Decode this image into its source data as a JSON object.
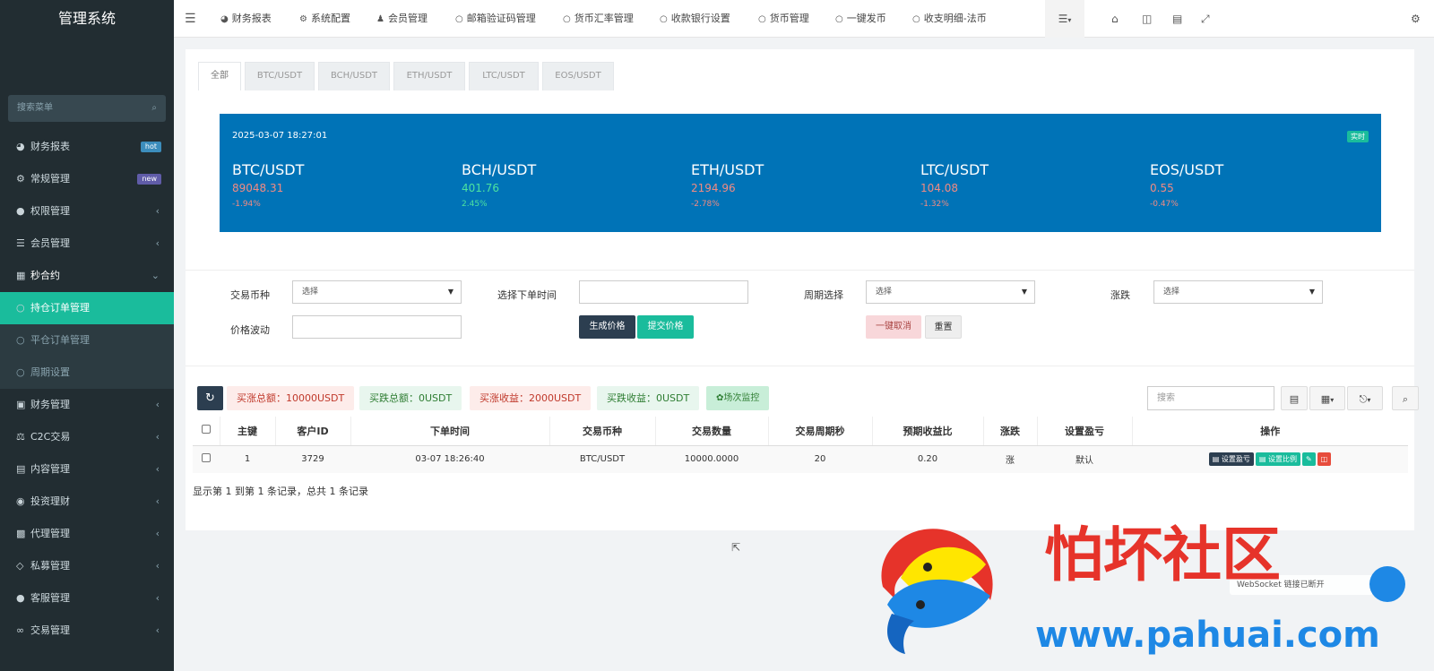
{
  "sidebar": {
    "brand": "管理系统",
    "search_placeholder": "搜索菜单",
    "items": [
      {
        "label": "财务报表",
        "icon": "dashboard-icon",
        "badge": "hot",
        "badge_color": "#3c8dbc"
      },
      {
        "label": "常规管理",
        "icon": "cogs-icon",
        "badge": "new",
        "badge_color": "#605ca8"
      },
      {
        "label": "权限管理",
        "icon": "group-icon"
      },
      {
        "label": "会员管理",
        "icon": "list-icon"
      },
      {
        "label": "秒合约",
        "icon": "calendar-icon"
      },
      {
        "label": "持仓订单管理",
        "icon": "circle-icon"
      },
      {
        "label": "平仓订单管理",
        "icon": "circle-icon"
      },
      {
        "label": "周期设置",
        "icon": "circle-icon"
      },
      {
        "label": "财务管理",
        "icon": "database-icon"
      },
      {
        "label": "C2C交易",
        "icon": "balance-icon"
      },
      {
        "label": "内容管理",
        "icon": "file-icon"
      },
      {
        "label": "投资理财",
        "icon": "money-icon"
      },
      {
        "label": "代理管理",
        "icon": "briefcase-icon"
      },
      {
        "label": "私募管理",
        "icon": "diamond-icon"
      },
      {
        "label": "客服管理",
        "icon": "comment-icon"
      },
      {
        "label": "交易管理",
        "icon": "handshake-icon"
      }
    ]
  },
  "topnav": {
    "items": [
      {
        "label": "财务报表",
        "icon": "dashboard-icon"
      },
      {
        "label": "系统配置",
        "icon": "gear-icon"
      },
      {
        "label": "会员管理",
        "icon": "user-icon"
      },
      {
        "label": "邮箱验证码管理",
        "icon": "circle-icon"
      },
      {
        "label": "货币汇率管理",
        "icon": "circle-icon"
      },
      {
        "label": "收款银行设置",
        "icon": "circle-icon"
      },
      {
        "label": "货币管理",
        "icon": "circle-icon"
      },
      {
        "label": "一键发币",
        "icon": "circle-icon"
      },
      {
        "label": "收支明细-法币",
        "icon": "circle-icon"
      }
    ]
  },
  "tabs": [
    "全部",
    "BTC/USDT",
    "BCH/USDT",
    "ETH/USDT",
    "LTC/USDT",
    "EOS/USDT"
  ],
  "ticker": {
    "datetime": "2025-03-07 18:27:01",
    "live_label": "实时",
    "coins": [
      {
        "name": "BTC/USDT",
        "price": "89048.31",
        "change": "-1.94%",
        "color": "#f28b82"
      },
      {
        "name": "BCH/USDT",
        "price": "401.76",
        "change": "2.45%",
        "color": "#4ce3a0"
      },
      {
        "name": "ETH/USDT",
        "price": "2194.96",
        "change": "-2.78%",
        "color": "#f28b82"
      },
      {
        "name": "LTC/USDT",
        "price": "104.08",
        "change": "-1.32%",
        "color": "#f28b82"
      },
      {
        "name": "EOS/USDT",
        "price": "0.55",
        "change": "-0.47%",
        "color": "#f28b82"
      }
    ]
  },
  "filters": {
    "coin_label": "交易币种",
    "coin_value": "选择",
    "time_label": "选择下单时间",
    "period_label": "周期选择",
    "period_value": "选择",
    "updown_label": "涨跌",
    "updown_value": "选择",
    "volatility_label": "价格波动",
    "gen_price": "生成价格",
    "submit_price": "提交价格",
    "cancel_all": "一键取消",
    "reset": "重置"
  },
  "stats": {
    "buy_up_total": "买涨总额：10000USDT",
    "buy_down_total": "买跌总额：0USDT",
    "buy_up_profit": "买涨收益：2000USDT",
    "buy_down_profit": "买跌收益：0USDT",
    "monitor": "场次监控"
  },
  "table": {
    "search_placeholder": "搜索",
    "headers": [
      "主键",
      "客户ID",
      "下单时间",
      "交易币种",
      "交易数量",
      "交易周期秒",
      "预期收益比",
      "涨跌",
      "设置盈亏",
      "操作"
    ],
    "rows": [
      [
        "1",
        "3729",
        "03-07 18:26:40",
        "BTC/USDT",
        "10000.0000",
        "20",
        "0.20",
        "涨",
        "默认"
      ]
    ],
    "action_set_pl": "设置盈亏",
    "action_set_ratio": "设置比例",
    "footer": "显示第 1 到第 1 条记录，总共 1 条记录"
  },
  "watermark": {
    "cn": "怕坏社区",
    "url": "www.pahuai.com",
    "ws_text": "WebSocket 链接已断开"
  },
  "colors": {
    "sidebar_bg": "#222d32",
    "active": "#1abc9c",
    "banner": "#0073b7",
    "danger": "#dd4b39",
    "dark_btn": "#2c3e50"
  }
}
